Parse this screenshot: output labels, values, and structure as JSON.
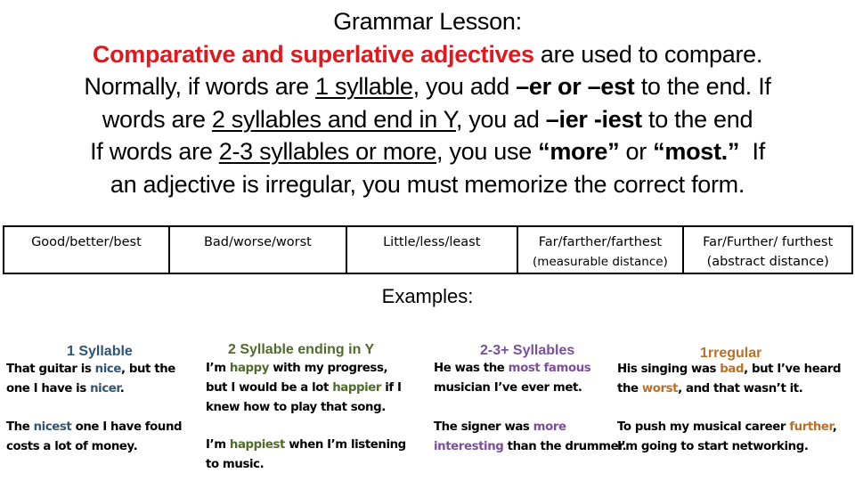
{
  "lesson": {
    "title": "Grammar Lesson:",
    "line2_red": "Comparative and superlative adjectives",
    "line2_rest": " are used to compare.",
    "line3_a": "Normally, if words are ",
    "line3_u": "1 syllable",
    "line3_b": ", you add ",
    "line3_bold": "–er or –est",
    "line3_c": " to the end. If",
    "line4_a": "words are ",
    "line4_u": "2 syllables and end in Y",
    "line4_b": ", you ad ",
    "line4_bold": "–ier -iest",
    "line4_c": " to the end",
    "line5_a": "If words are ",
    "line5_u": "2-3 syllables or more",
    "line5_b": ", you use ",
    "line5_bold1": "“more”",
    "line5_c": " or ",
    "line5_bold2": "“most.”",
    "line5_d": "  If",
    "line6": "an adjective is irregular, you must memorize the correct form."
  },
  "irregular_table": [
    {
      "main": "Good/better/best",
      "sub": ""
    },
    {
      "main": "Bad/worse/worst",
      "sub": ""
    },
    {
      "main": "Little/less/least",
      "sub": ""
    },
    {
      "main": "Far/farther/farthest",
      "sub": "(measurable distance)"
    },
    {
      "main": "Far/Further/ furthest",
      "sub": "(abstract distance)"
    }
  ],
  "examples": {
    "title": "Examples:",
    "columns": [
      {
        "heading": "1 Syllable",
        "heading_color": "#2f5474",
        "ex1": {
          "a": "That guitar is ",
          "h1": "nice",
          "b": ", but the",
          "c": "one I have is ",
          "h2": "nicer",
          "d": "."
        },
        "ex2": {
          "a": "The ",
          "h1": "nicest",
          "b": " one I have found",
          "c": "costs a lot of money."
        }
      },
      {
        "heading": "2 Syllable ending in Y",
        "heading_color": "#4f6b2e",
        "ex1": {
          "a": "I’m ",
          "h1": "happy",
          "b": " with my progress,",
          "c": "but I would be a lot ",
          "h2": "happier",
          "d": " if I",
          "e": "knew how to play that song."
        },
        "ex2": {
          "a": "I’m ",
          "h1": "happiest",
          "b": " when I’m listening",
          "c": "to music."
        }
      },
      {
        "heading": "2-3+ Syllables",
        "heading_color": "#7b4f99",
        "ex1": {
          "a": "He was the ",
          "h1": "most famous",
          "b": "musician I’ve ever met."
        },
        "ex2": {
          "a": "The signer was ",
          "h1": "more",
          "h2": "interesting",
          "b": " than the drummer."
        }
      },
      {
        "heading": "1rregular",
        "heading_color": "#b8702a",
        "ex1": {
          "a": "His singing was ",
          "h1": "bad",
          "b": ", but I’ve heard",
          "c": "the ",
          "h2": "worst",
          "d": ", and that wasn’t it."
        },
        "ex2": {
          "a": "To push my musical career ",
          "h1": "further",
          "b": ",",
          "c": "I’m going to start networking."
        }
      }
    ]
  }
}
